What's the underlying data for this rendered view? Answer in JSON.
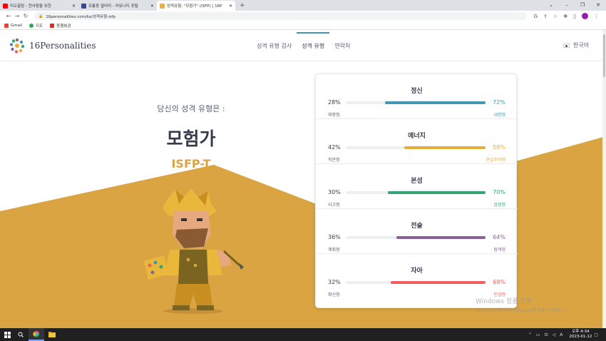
{
  "browser": {
    "tabs": [
      {
        "title": "미오꿀잠 - 현사람을 위한 ",
        "favicon_color": "#ff0000"
      },
      {
        "title": "유통증 갤러리 - 커뮤니티 포털",
        "favicon_color": "#3b4890"
      },
      {
        "title": "성격유형: \"모험가\" (ISFP) | 16P",
        "favicon_color": "#e8b04a"
      }
    ],
    "active_tab": 2,
    "new_tab": "+",
    "url": "16personalities.com/ko/성격유형-isfp",
    "bookmarks": [
      {
        "label": "Gmail",
        "color": "#ea4335"
      },
      {
        "label": "지도",
        "color": "#34a853"
      },
      {
        "label": "동행복권",
        "color": "#d93025"
      }
    ]
  },
  "site": {
    "logo_text": "16Personalities",
    "nav": [
      "성격 유형 검사",
      "성격 유형",
      "연락처"
    ],
    "nav_active": 1,
    "language": "한국어"
  },
  "result": {
    "intro": "당신의 성격 유형은 :",
    "type_name": "모험가",
    "type_code": "ISFP-T"
  },
  "traits": [
    {
      "title": "정신",
      "left_pct": "28%",
      "right_pct": "72%",
      "left_label": "외향형",
      "right_label": "내향형",
      "value": 72,
      "side": "right",
      "color": "#4298b4"
    },
    {
      "title": "에너지",
      "left_pct": "42%",
      "right_pct": "58%",
      "left_label": "직관형",
      "right_label": "현실주의형",
      "value": 58,
      "side": "right",
      "color": "#e4ae3a"
    },
    {
      "title": "본성",
      "left_pct": "30%",
      "right_pct": "70%",
      "left_label": "사고형",
      "right_label": "감정형",
      "value": 70,
      "side": "right",
      "color": "#33a474"
    },
    {
      "title": "전술",
      "left_pct": "36%",
      "right_pct": "64%",
      "left_label": "계획형",
      "right_label": "탐색형",
      "value": 64,
      "side": "right",
      "color": "#88619a"
    },
    {
      "title": "자아",
      "left_pct": "32%",
      "right_pct": "68%",
      "left_label": "확신형",
      "right_label": "민감형",
      "value": 68,
      "side": "right",
      "color": "#f25e62"
    }
  ],
  "watermark": {
    "line1": "Windows 정품 인증",
    "line2": "[설정]으로 이동하여 Windows를 정품 인증합니다."
  },
  "taskbar": {
    "time": "오후 4:34",
    "date": "2023-01-12"
  },
  "colors": {
    "accent_bg": "#d9a441",
    "text_dark": "#343c4b"
  }
}
